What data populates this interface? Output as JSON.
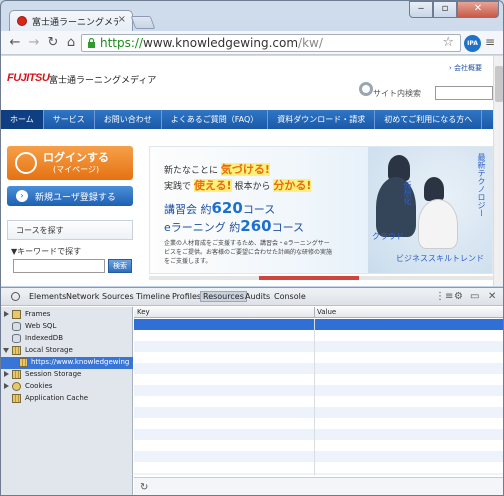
{
  "browser": {
    "tab_title": "富士通ラーニングメディア",
    "tab_close": "×",
    "window_min": "‒",
    "window_max": "▫",
    "window_close": "✕",
    "url_scheme": "https://",
    "url_host": "www.knowledgewing.com",
    "url_path": "/kw/",
    "ext_badge": "IPA"
  },
  "site": {
    "logo": "FUJITSU",
    "name": "富士通ラーニングメディア",
    "corp_link": "会社概要",
    "search_label": "サイト内検索",
    "nav": [
      "ホーム",
      "サービス",
      "お問い合わせ",
      "よくあるご質問（FAQ）",
      "資料ダウンロード・請求",
      "初めてご利用になる方へ"
    ],
    "login_main": "ログインする",
    "login_sub": "(マイページ)",
    "register": "新規ユーザ登録する",
    "course_search": "コースを探す",
    "keyword_label": "▼キーワードで探す",
    "search_button": "検索"
  },
  "banner": {
    "line1_pre": "新たなことに",
    "line1_hl": "気づける!",
    "line2_pre": "実践で",
    "line2_hl1": "使える!",
    "line2_mid": "根本から",
    "line2_hl2": "分かる!",
    "count1_pre": "講習会 約",
    "count1_num": "620",
    "count1_post": "コース",
    "count2_pre": "eラーニング 約",
    "count2_num": "260",
    "count2_post": "コース",
    "desc": "企業の人材育成をご支援するため、講習会・eラーニングサービスをご提供。お客様のご要望に合わせた計画的な研修の実施をご支援します。",
    "tags": [
      "最新テクノロジー",
      "仮想化",
      "クラウド",
      "ビジネススキルトレンド"
    ]
  },
  "devtools": {
    "tabs": [
      "Elements",
      "Network",
      "Sources",
      "Timeline",
      "Profiles",
      "Resources",
      "Audits",
      "Console"
    ],
    "active_tab": "Resources",
    "tree": [
      {
        "label": "Frames",
        "icon": "folder-icon",
        "arrow": "right"
      },
      {
        "label": "Web SQL",
        "icon": "database-icon",
        "arrow": "none"
      },
      {
        "label": "IndexedDB",
        "icon": "database-icon",
        "arrow": "none"
      },
      {
        "label": "Local Storage",
        "icon": "grid-icon",
        "arrow": "down"
      },
      {
        "label": "https://www.knowledgewing.com",
        "icon": "grid-icon",
        "arrow": "none"
      },
      {
        "label": "Session Storage",
        "icon": "grid-icon",
        "arrow": "right"
      },
      {
        "label": "Cookies",
        "icon": "cookie-icon",
        "arrow": "right"
      },
      {
        "label": "Application Cache",
        "icon": "grid-icon",
        "arrow": "none"
      }
    ],
    "selected_label": "https://www.knowledgewing.com",
    "col_key": "Key",
    "col_value": "Value"
  },
  "colors": {
    "brand_red": "#d4161c",
    "nav_blue": "#1a59a8",
    "selection_blue": "#3875d7",
    "accent_orange": "#e57212"
  }
}
